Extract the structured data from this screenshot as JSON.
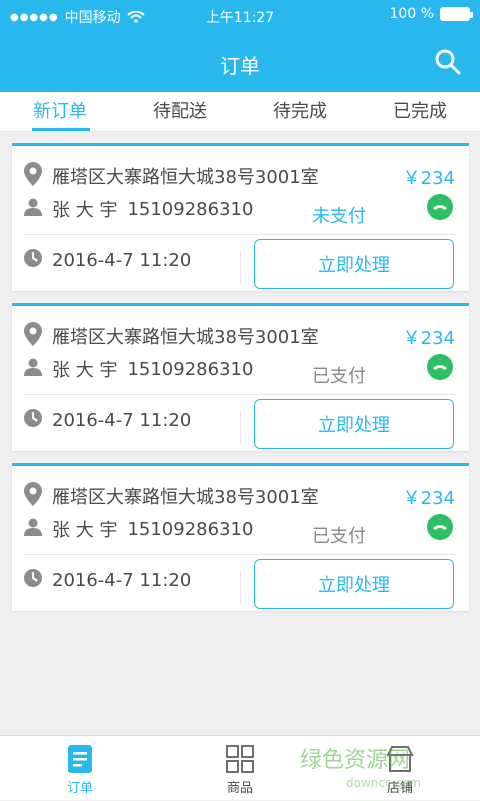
{
  "status_bar": {
    "carrier": "中国移动",
    "time": "上午11:27",
    "battery": "100 %"
  },
  "header": {
    "title": "订单"
  },
  "tabs": [
    {
      "label": "新订单",
      "active": true
    },
    {
      "label": "待配送",
      "active": false
    },
    {
      "label": "待完成",
      "active": false
    },
    {
      "label": "已完成",
      "active": false
    }
  ],
  "orders": [
    {
      "address": "雁塔区大寨路恒大城38号3001室",
      "price": "￥234",
      "customer": "张 大 宇",
      "phone": "15109286310",
      "pay_status": "未支付",
      "time": "2016-4-7  11:20",
      "action": "立即处理"
    },
    {
      "address": "雁塔区大寨路恒大城38号3001室",
      "price": "￥234",
      "customer": "张 大 宇",
      "phone": "15109286310",
      "pay_status": "已支付",
      "time": "2016-4-7  11:20",
      "action": "立即处理"
    },
    {
      "address": "雁塔区大寨路恒大城38号3001室",
      "price": "￥234",
      "customer": "张 大 宇",
      "phone": "15109286310",
      "pay_status": "已支付",
      "time": "2016-4-7  11:20",
      "action": "立即处理"
    }
  ],
  "bottom_nav": [
    {
      "label": "订单",
      "icon": "order-icon",
      "active": true
    },
    {
      "label": "商品",
      "icon": "grid-icon",
      "active": false
    },
    {
      "label": "店铺",
      "icon": "store-icon",
      "active": false
    }
  ],
  "watermark": {
    "text": "绿色资源网",
    "sub": "downcc.com"
  },
  "colors": {
    "accent": "#29b8ee",
    "phone": "#2dbf62",
    "background": "#efefef"
  }
}
